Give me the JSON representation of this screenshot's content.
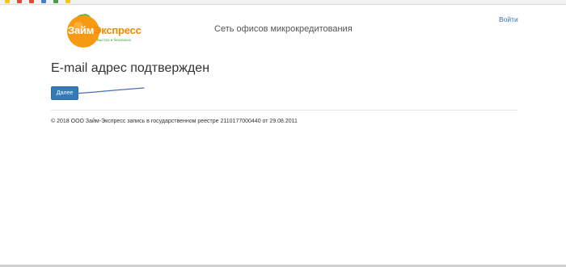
{
  "header": {
    "network_title": "Сеть офисов микрокредитования",
    "login_label": "Войти"
  },
  "logo": {
    "word_part1": "Займ",
    "word_part2": "Экспресс",
    "tagline": "Быстро и безопасно",
    "colors": {
      "orange": "#f08a00",
      "green": "#3aa535"
    }
  },
  "main": {
    "title": "E-mail адрес подтвержден",
    "next_label": "Далее"
  },
  "footer": {
    "copyright": "© 2018 ООО Займ-Экспресс запись в государственном реестре 2110177000440 от 29.08.2011"
  },
  "colors": {
    "accent": "#337ab7",
    "link": "#3b6fb3",
    "annotation": "#4a6fb5"
  }
}
